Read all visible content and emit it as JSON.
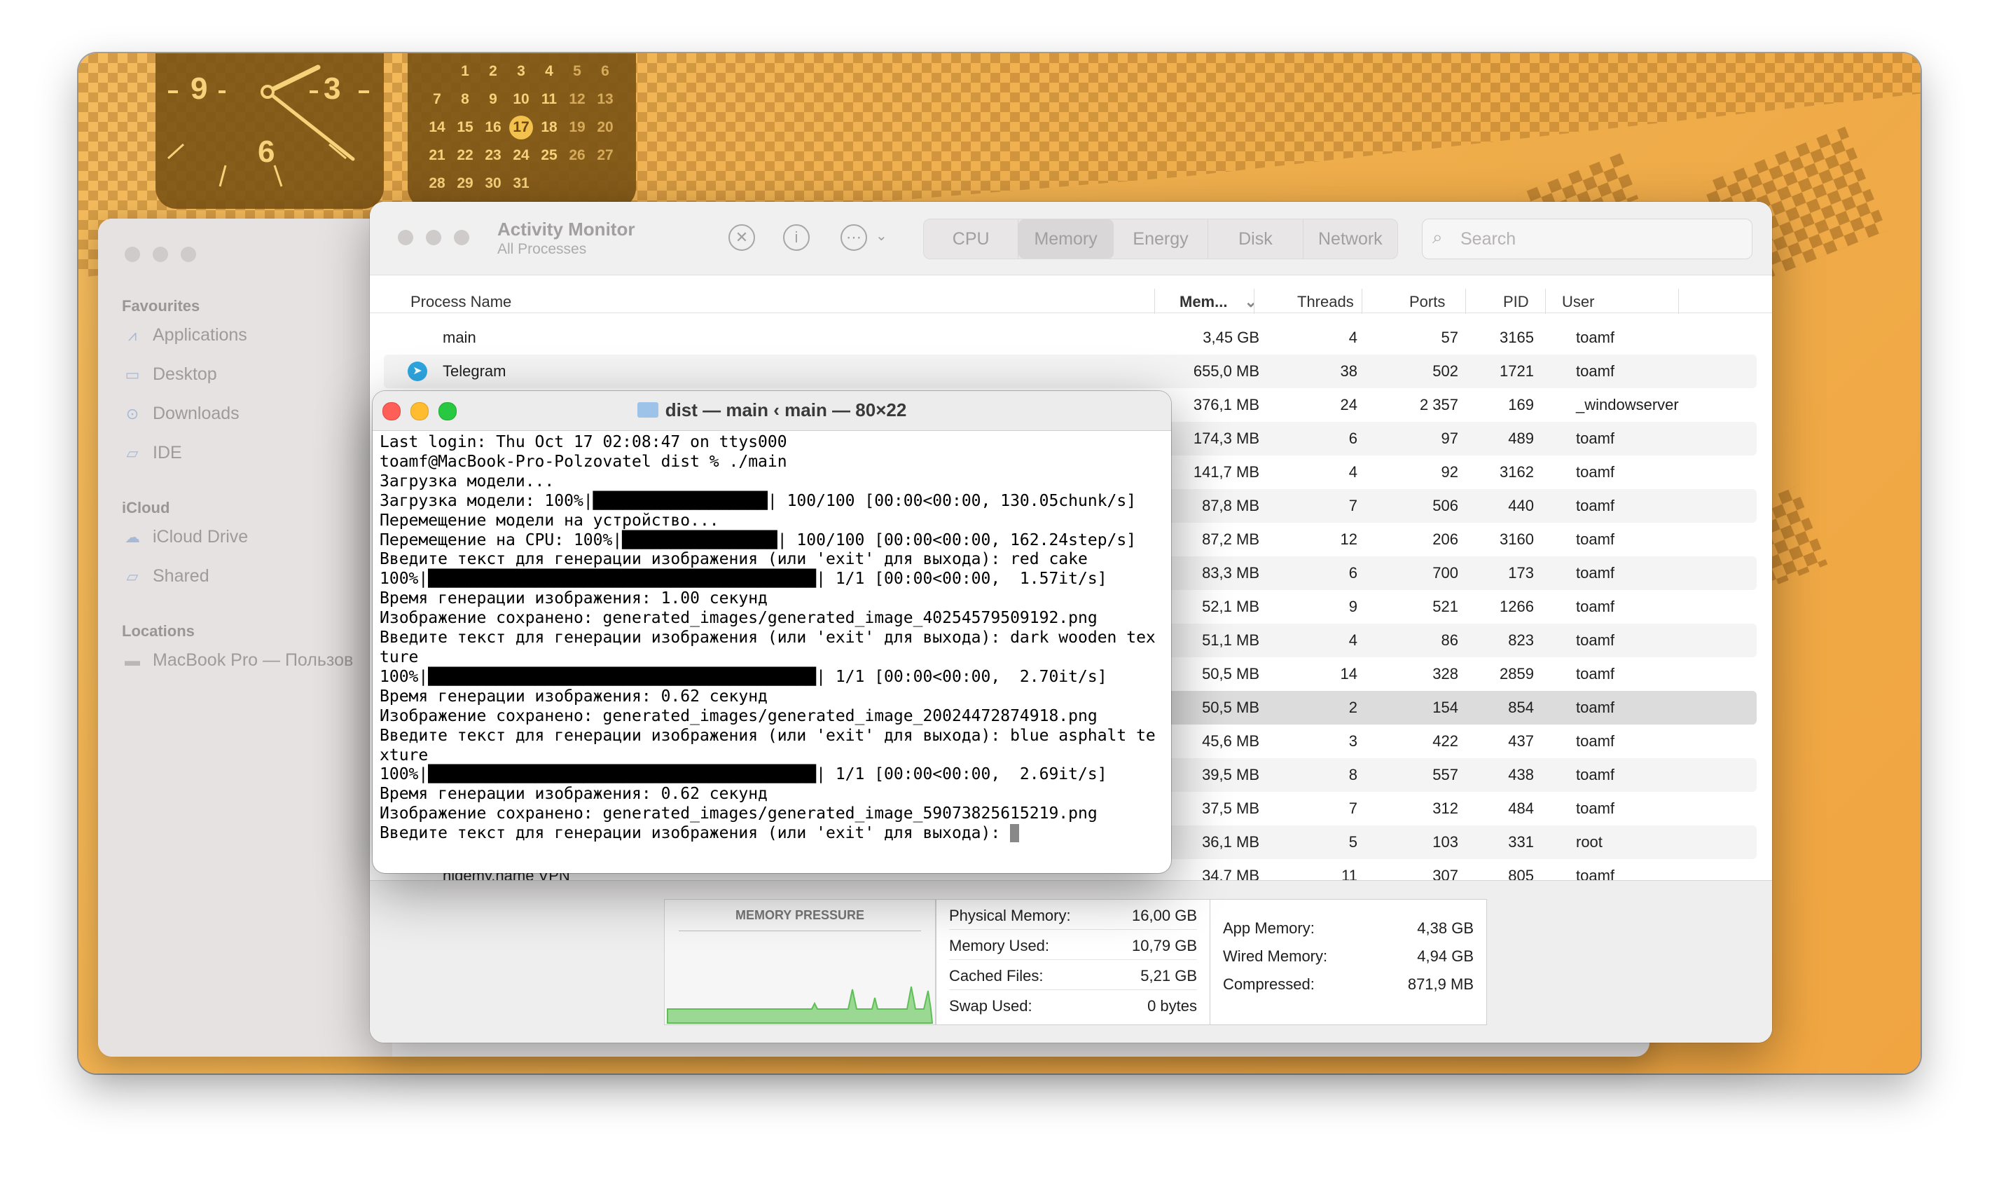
{
  "clock": {
    "numerals": [
      "9",
      "3",
      "6"
    ]
  },
  "calendar": {
    "rows": [
      [
        "",
        "",
        "1",
        "2",
        "3",
        "4",
        "5",
        "6"
      ],
      [
        "7",
        "8",
        "9",
        "10",
        "11",
        "12",
        "13"
      ],
      [
        "14",
        "15",
        "16",
        "17",
        "18",
        "19",
        "20"
      ],
      [
        "21",
        "22",
        "23",
        "24",
        "25",
        "26",
        "27"
      ],
      [
        "28",
        "29",
        "30",
        "31"
      ]
    ],
    "days": [
      "",
      "1",
      "2",
      "3",
      "4",
      "5",
      "6",
      "7",
      "8",
      "9",
      "10",
      "11",
      "12",
      "13",
      "14",
      "15",
      "16",
      "17",
      "18",
      "19",
      "20",
      "21",
      "22",
      "23",
      "24",
      "25",
      "26",
      "27",
      "28",
      "29",
      "30",
      "31"
    ],
    "today": "17"
  },
  "finder": {
    "favourites_label": "Favourites",
    "favourites": [
      "Applications",
      "Desktop",
      "Downloads",
      "IDE"
    ],
    "icloud_label": "iCloud",
    "icloud": [
      "iCloud Drive",
      "Shared"
    ],
    "locations_label": "Locations",
    "locations": [
      "MacBook Pro — Пользов"
    ]
  },
  "activity_monitor": {
    "title": "Activity Monitor",
    "subtitle": "All Processes",
    "tabs": [
      "CPU",
      "Memory",
      "Energy",
      "Disk",
      "Network"
    ],
    "active_tab": "Memory",
    "search_placeholder": "Search",
    "columns": {
      "name": "Process Name",
      "memory": "Mem...",
      "threads": "Threads",
      "ports": "Ports",
      "pid": "PID",
      "user": "User"
    },
    "rows": [
      {
        "name": "main",
        "mem": "3,45 GB",
        "threads": "4",
        "ports": "57",
        "pid": "3165",
        "user": "toamf"
      },
      {
        "name": "Telegram",
        "mem": "655,0 MB",
        "threads": "38",
        "ports": "502",
        "pid": "1721",
        "user": "toamf"
      },
      {
        "name": "",
        "mem": "376,1 MB",
        "threads": "24",
        "ports": "2 357",
        "pid": "169",
        "user": "_windowserver"
      },
      {
        "name": "",
        "mem": "174,3 MB",
        "threads": "6",
        "ports": "97",
        "pid": "489",
        "user": "toamf"
      },
      {
        "name": "",
        "mem": "141,7 MB",
        "threads": "4",
        "ports": "92",
        "pid": "3162",
        "user": "toamf"
      },
      {
        "name": "",
        "mem": "87,8 MB",
        "threads": "7",
        "ports": "506",
        "pid": "440",
        "user": "toamf"
      },
      {
        "name": "",
        "mem": "87,2 MB",
        "threads": "12",
        "ports": "206",
        "pid": "3160",
        "user": "toamf"
      },
      {
        "name": "",
        "mem": "83,3 MB",
        "threads": "6",
        "ports": "700",
        "pid": "173",
        "user": "toamf"
      },
      {
        "name": "",
        "mem": "52,1 MB",
        "threads": "9",
        "ports": "521",
        "pid": "1266",
        "user": "toamf"
      },
      {
        "name": "",
        "mem": "51,1 MB",
        "threads": "4",
        "ports": "86",
        "pid": "823",
        "user": "toamf"
      },
      {
        "name": "",
        "mem": "50,5 MB",
        "threads": "14",
        "ports": "328",
        "pid": "2859",
        "user": "toamf"
      },
      {
        "name": "",
        "mem": "50,5 MB",
        "threads": "2",
        "ports": "154",
        "pid": "854",
        "user": "toamf"
      },
      {
        "name": "",
        "mem": "45,6 MB",
        "threads": "3",
        "ports": "422",
        "pid": "437",
        "user": "toamf"
      },
      {
        "name": "",
        "mem": "39,5 MB",
        "threads": "8",
        "ports": "557",
        "pid": "438",
        "user": "toamf"
      },
      {
        "name": "",
        "mem": "37,5 MB",
        "threads": "7",
        "ports": "312",
        "pid": "484",
        "user": "toamf"
      },
      {
        "name": "",
        "mem": "36,1 MB",
        "threads": "5",
        "ports": "103",
        "pid": "331",
        "user": "root"
      },
      {
        "name": "hidemy.name VPN",
        "mem": "34,7 MB",
        "threads": "11",
        "ports": "307",
        "pid": "805",
        "user": "toamf"
      }
    ],
    "memory_pressure_label": "MEMORY PRESSURE",
    "stats_left": [
      {
        "label": "Physical Memory:",
        "value": "16,00 GB"
      },
      {
        "label": "Memory Used:",
        "value": "10,79 GB"
      },
      {
        "label": "Cached Files:",
        "value": "5,21 GB"
      },
      {
        "label": "Swap Used:",
        "value": "0 bytes"
      }
    ],
    "stats_right": [
      {
        "label": "App Memory:",
        "value": "4,38 GB"
      },
      {
        "label": "Wired Memory:",
        "value": "4,94 GB"
      },
      {
        "label": "Compressed:",
        "value": "871,9 MB"
      }
    ]
  },
  "terminal": {
    "title": "dist — main ‹ main — 80×22",
    "lines": [
      "Last login: Thu Oct 17 02:08:47 on ttys000",
      "toamf@MacBook-Pro-Polzovatel dist % ./main",
      "Загрузка модели...",
      "Загрузка модели: 100%|██████████████████| 100/100 [00:00<00:00, 130.05chunk/s]",
      "Перемещение модели на устройство...",
      "Перемещение на CPU: 100%|████████████████| 100/100 [00:00<00:00, 162.24step/s]",
      "Введите текст для генерации изображения (или 'exit' для выхода): red cake",
      "100%|████████████████████████████████████████| 1/1 [00:00<00:00,  1.57it/s]",
      "Время генерации изображения: 1.00 секунд",
      "Изображение сохранено: generated_images/generated_image_40254579509192.png",
      "Введите текст для генерации изображения (или 'exit' для выхода): dark wooden tex",
      "ture",
      "100%|████████████████████████████████████████| 1/1 [00:00<00:00,  2.70it/s]",
      "Время генерации изображения: 0.62 секунд",
      "Изображение сохранено: generated_images/generated_image_20024472874918.png",
      "Введите текст для генерации изображения (или 'exit' для выхода): blue asphalt te",
      "xture",
      "100%|████████████████████████████████████████| 1/1 [00:00<00:00,  2.69it/s]",
      "Время генерации изображения: 0.62 секунд",
      "Изображение сохранено: generated_images/generated_image_59073825615219.png",
      "Введите текст для генерации изображения (или 'exit' для выхода): "
    ]
  },
  "colors": {
    "desktop": "#f0ab46",
    "widget": "#7d5516",
    "close": "#ff5f57",
    "minimize": "#febc2e",
    "zoom": "#28c840",
    "pressure": "#8fd18a"
  }
}
